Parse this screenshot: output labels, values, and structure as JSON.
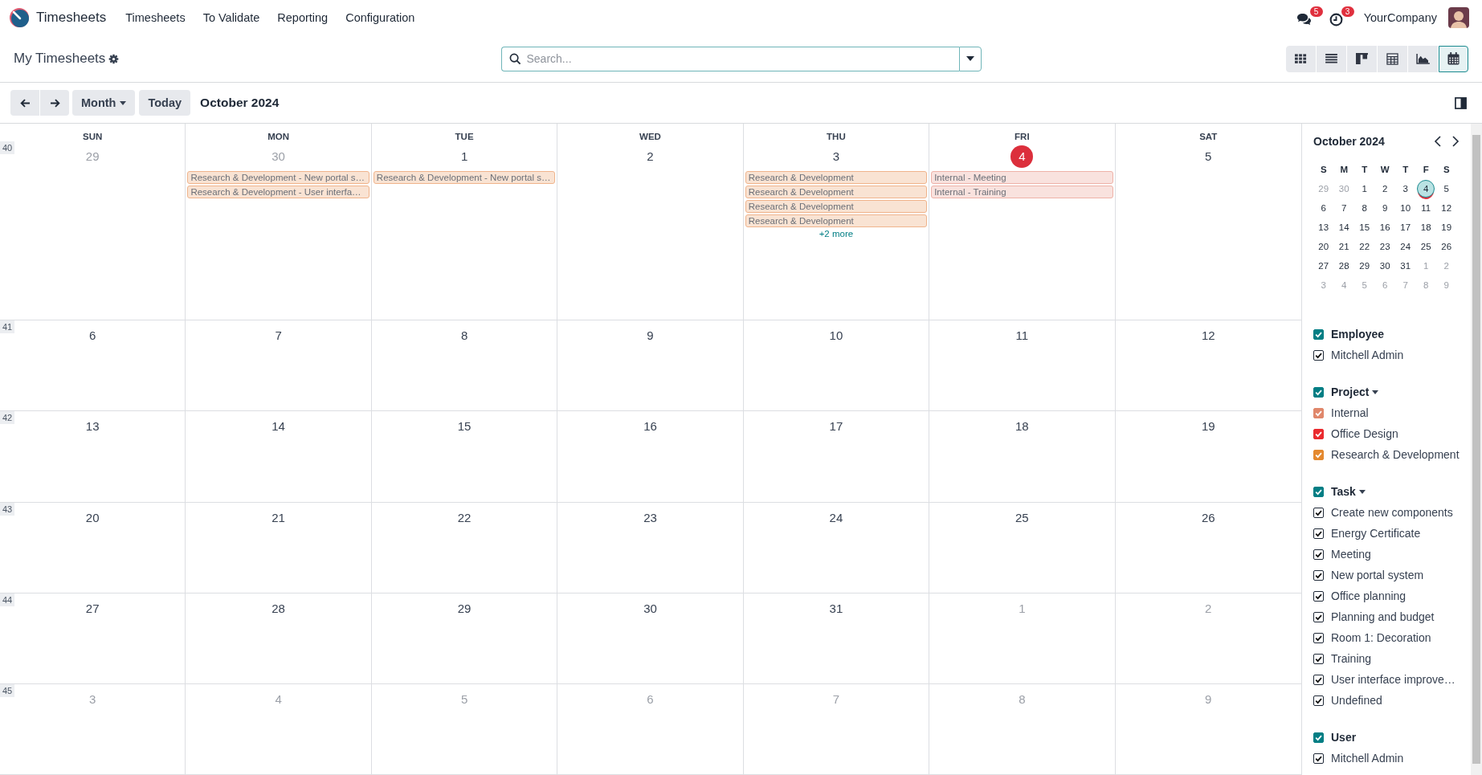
{
  "navbar": {
    "app_name": "Timesheets",
    "menu": [
      "Timesheets",
      "To Validate",
      "Reporting",
      "Configuration"
    ],
    "messages_badge": "5",
    "activities_badge": "3",
    "company": "YourCompany"
  },
  "control_panel": {
    "breadcrumb": "My Timesheets",
    "search": {
      "placeholder": "Search..."
    },
    "views": [
      {
        "kind": "kanban",
        "selected": false
      },
      {
        "kind": "list",
        "selected": false
      },
      {
        "kind": "board",
        "selected": false
      },
      {
        "kind": "pivot",
        "selected": false
      },
      {
        "kind": "graph",
        "selected": false
      },
      {
        "kind": "calendar",
        "selected": true
      }
    ]
  },
  "toolbar": {
    "scale": "Month",
    "today": "Today",
    "title": "October 2024"
  },
  "calendar": {
    "weekdays": [
      "SUN",
      "MON",
      "TUE",
      "WED",
      "THU",
      "FRI",
      "SAT"
    ],
    "weeks": [
      {
        "number": "40",
        "days": [
          {
            "label": "29",
            "muted": true,
            "today": false
          },
          {
            "label": "30",
            "muted": true,
            "today": false,
            "events": [
              {
                "text": "Research & Development - New portal s…",
                "color": "#f0b48c"
              },
              {
                "text": "Research & Development - User interfa…",
                "color": "#f0b48c"
              }
            ]
          },
          {
            "label": "1",
            "muted": false,
            "today": false,
            "events": [
              {
                "text": "Research & Development - New portal s…",
                "color": "#f0b48c"
              }
            ]
          },
          {
            "label": "2",
            "muted": false,
            "today": false
          },
          {
            "label": "3",
            "muted": false,
            "today": false,
            "events": [
              {
                "text": "Research & Development",
                "color": "#f0b48c"
              },
              {
                "text": "Research & Development",
                "color": "#f0b48c"
              },
              {
                "text": "Research & Development",
                "color": "#f0b48c"
              },
              {
                "text": "Research & Development",
                "color": "#f0b48c"
              }
            ],
            "more": "+2 more"
          },
          {
            "label": "4",
            "muted": false,
            "today": true,
            "events": [
              {
                "text": "Internal - Meeting",
                "color": "#eeb2a8"
              },
              {
                "text": "Internal - Training",
                "color": "#eeb2a8"
              }
            ]
          },
          {
            "label": "5",
            "muted": false,
            "today": false
          }
        ]
      },
      {
        "number": "41",
        "days": [
          {
            "label": "6",
            "muted": false,
            "today": false
          },
          {
            "label": "7",
            "muted": false,
            "today": false
          },
          {
            "label": "8",
            "muted": false,
            "today": false
          },
          {
            "label": "9",
            "muted": false,
            "today": false
          },
          {
            "label": "10",
            "muted": false,
            "today": false
          },
          {
            "label": "11",
            "muted": false,
            "today": false
          },
          {
            "label": "12",
            "muted": false,
            "today": false
          }
        ]
      },
      {
        "number": "42",
        "days": [
          {
            "label": "13",
            "muted": false,
            "today": false
          },
          {
            "label": "14",
            "muted": false,
            "today": false
          },
          {
            "label": "15",
            "muted": false,
            "today": false
          },
          {
            "label": "16",
            "muted": false,
            "today": false
          },
          {
            "label": "17",
            "muted": false,
            "today": false
          },
          {
            "label": "18",
            "muted": false,
            "today": false
          },
          {
            "label": "19",
            "muted": false,
            "today": false
          }
        ]
      },
      {
        "number": "43",
        "days": [
          {
            "label": "20",
            "muted": false,
            "today": false
          },
          {
            "label": "21",
            "muted": false,
            "today": false
          },
          {
            "label": "22",
            "muted": false,
            "today": false
          },
          {
            "label": "23",
            "muted": false,
            "today": false
          },
          {
            "label": "24",
            "muted": false,
            "today": false
          },
          {
            "label": "25",
            "muted": false,
            "today": false
          },
          {
            "label": "26",
            "muted": false,
            "today": false
          }
        ]
      },
      {
        "number": "44",
        "days": [
          {
            "label": "27",
            "muted": false,
            "today": false
          },
          {
            "label": "28",
            "muted": false,
            "today": false
          },
          {
            "label": "29",
            "muted": false,
            "today": false
          },
          {
            "label": "30",
            "muted": false,
            "today": false
          },
          {
            "label": "31",
            "muted": false,
            "today": false
          },
          {
            "label": "1",
            "muted": true,
            "today": false
          },
          {
            "label": "2",
            "muted": true,
            "today": false
          }
        ]
      },
      {
        "number": "45",
        "days": [
          {
            "label": "3",
            "muted": true,
            "today": false
          },
          {
            "label": "4",
            "muted": true,
            "today": false
          },
          {
            "label": "5",
            "muted": true,
            "today": false
          },
          {
            "label": "6",
            "muted": true,
            "today": false
          },
          {
            "label": "7",
            "muted": true,
            "today": false
          },
          {
            "label": "8",
            "muted": true,
            "today": false
          },
          {
            "label": "9",
            "muted": true,
            "today": false
          }
        ]
      }
    ]
  },
  "sidebar": {
    "mini_calendar": {
      "title": "October 2024",
      "weekdays": [
        "S",
        "M",
        "T",
        "W",
        "T",
        "F",
        "S"
      ],
      "weeks": [
        [
          {
            "label": "29",
            "muted": true,
            "selected": false
          },
          {
            "label": "30",
            "muted": true,
            "selected": false
          },
          {
            "label": "1",
            "muted": false,
            "selected": false
          },
          {
            "label": "2",
            "muted": false,
            "selected": false
          },
          {
            "label": "3",
            "muted": false,
            "selected": false
          },
          {
            "label": "4",
            "muted": false,
            "selected": true
          },
          {
            "label": "5",
            "muted": false,
            "selected": false
          }
        ],
        [
          {
            "label": "6",
            "muted": false,
            "selected": false
          },
          {
            "label": "7",
            "muted": false,
            "selected": false
          },
          {
            "label": "8",
            "muted": false,
            "selected": false
          },
          {
            "label": "9",
            "muted": false,
            "selected": false
          },
          {
            "label": "10",
            "muted": false,
            "selected": false
          },
          {
            "label": "11",
            "muted": false,
            "selected": false
          },
          {
            "label": "12",
            "muted": false,
            "selected": false
          }
        ],
        [
          {
            "label": "13",
            "muted": false,
            "selected": false
          },
          {
            "label": "14",
            "muted": false,
            "selected": false
          },
          {
            "label": "15",
            "muted": false,
            "selected": false
          },
          {
            "label": "16",
            "muted": false,
            "selected": false
          },
          {
            "label": "17",
            "muted": false,
            "selected": false
          },
          {
            "label": "18",
            "muted": false,
            "selected": false
          },
          {
            "label": "19",
            "muted": false,
            "selected": false
          }
        ],
        [
          {
            "label": "20",
            "muted": false,
            "selected": false
          },
          {
            "label": "21",
            "muted": false,
            "selected": false
          },
          {
            "label": "22",
            "muted": false,
            "selected": false
          },
          {
            "label": "23",
            "muted": false,
            "selected": false
          },
          {
            "label": "24",
            "muted": false,
            "selected": false
          },
          {
            "label": "25",
            "muted": false,
            "selected": false
          },
          {
            "label": "26",
            "muted": false,
            "selected": false
          }
        ],
        [
          {
            "label": "27",
            "muted": false,
            "selected": false
          },
          {
            "label": "28",
            "muted": false,
            "selected": false
          },
          {
            "label": "29",
            "muted": false,
            "selected": false
          },
          {
            "label": "30",
            "muted": false,
            "selected": false
          },
          {
            "label": "31",
            "muted": false,
            "selected": false
          },
          {
            "label": "1",
            "muted": true,
            "selected": false
          },
          {
            "label": "2",
            "muted": true,
            "selected": false
          }
        ],
        [
          {
            "label": "3",
            "muted": true,
            "selected": false
          },
          {
            "label": "4",
            "muted": true,
            "selected": false
          },
          {
            "label": "5",
            "muted": true,
            "selected": false
          },
          {
            "label": "6",
            "muted": true,
            "selected": false
          },
          {
            "label": "7",
            "muted": true,
            "selected": false
          },
          {
            "label": "8",
            "muted": true,
            "selected": false
          },
          {
            "label": "9",
            "muted": true,
            "selected": false
          }
        ]
      ]
    },
    "filters": [
      {
        "title": "Employee",
        "checked": true,
        "dropdown": false,
        "items": [
          {
            "label": "Mitchell Admin",
            "checked": true
          }
        ]
      },
      {
        "title": "Project",
        "checked": true,
        "dropdown": true,
        "items": [
          {
            "label": "Internal",
            "checked": true,
            "color": "#e0876b"
          },
          {
            "label": "Office Design",
            "checked": true,
            "color": "#ea2a2e"
          },
          {
            "label": "Research & Development",
            "checked": true,
            "color": "#e4892f"
          }
        ]
      },
      {
        "title": "Task",
        "checked": true,
        "dropdown": true,
        "items": [
          {
            "label": "Create new components",
            "checked": true
          },
          {
            "label": "Energy Certificate",
            "checked": true
          },
          {
            "label": "Meeting",
            "checked": true
          },
          {
            "label": "New portal system",
            "checked": true
          },
          {
            "label": "Office planning",
            "checked": true
          },
          {
            "label": "Planning and budget",
            "checked": true
          },
          {
            "label": "Room 1: Decoration",
            "checked": true
          },
          {
            "label": "Training",
            "checked": true
          },
          {
            "label": "User interface improve…",
            "checked": true
          },
          {
            "label": "Undefined",
            "checked": true
          }
        ]
      },
      {
        "title": "User",
        "checked": true,
        "dropdown": false,
        "items": [
          {
            "label": "Mitchell Admin",
            "checked": true
          }
        ]
      }
    ]
  }
}
